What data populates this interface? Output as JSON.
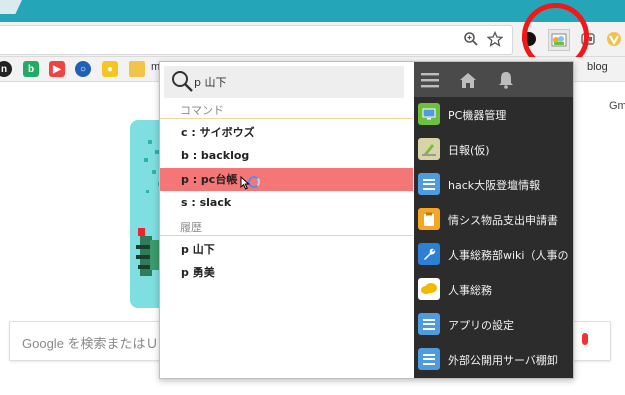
{
  "browser": {
    "bookmark_text_m": "m",
    "bookmark_text_blog": "blog",
    "bookmark_icons": [
      "bookmark-n-icon",
      "bookmark-b-icon",
      "bookmark-media-icon",
      "bookmark-ring-icon",
      "bookmark-yellow-icon",
      "folder-icon"
    ],
    "toolbar_icons": [
      "zoom-icon",
      "star-icon",
      "extension-dot-icon",
      "extension-launcher-icon",
      "extension-card-icon",
      "extension-v-icon"
    ],
    "gm_text": "Gm"
  },
  "google": {
    "search_placeholder": "Google を検索またはＵ"
  },
  "popup": {
    "search_query": "p 山下",
    "commands_label": "コマンド",
    "commands": [
      {
        "label": "c : サイボウズ",
        "selected": false
      },
      {
        "label": "b : backlog",
        "selected": false
      },
      {
        "label": "p : pc台帳",
        "selected": true
      },
      {
        "label": "s : slack",
        "selected": false
      }
    ],
    "history_label": "履歴",
    "history": [
      {
        "label": "p 山下"
      },
      {
        "label": "p 勇美"
      }
    ],
    "header_icons": [
      "menu-icon",
      "home-icon",
      "bell-icon"
    ],
    "apps": [
      {
        "label": "PC機器管理",
        "icon": "monitor-icon",
        "color": "#6fbf3f"
      },
      {
        "label": "日報(仮)",
        "icon": "diary-icon",
        "color": "#d9d4a5"
      },
      {
        "label": "hack大阪登壇情報",
        "icon": "list-icon",
        "color": "#4f9be0"
      },
      {
        "label": "情シス物品支出申請書",
        "icon": "clipboard-icon",
        "color": "#f5a623"
      },
      {
        "label": "人事総務部wiki（人事の",
        "icon": "wrench-icon",
        "color": "#2d7fd3"
      },
      {
        "label": "人事総務",
        "icon": "cloud-icon",
        "color": "#f5b800"
      },
      {
        "label": "アプリの設定",
        "icon": "list-icon",
        "color": "#4f9be0"
      },
      {
        "label": "外部公開用サーバ棚卸",
        "icon": "list-icon",
        "color": "#4f9be0"
      }
    ]
  }
}
